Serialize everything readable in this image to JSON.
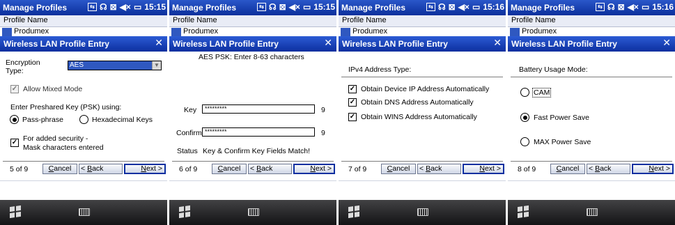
{
  "common": {
    "app_title": "Manage Profiles",
    "list_header": "Profile Name",
    "list_item": "Produmex",
    "dialog_title": "Wireless LAN Profile Entry",
    "close": "✕",
    "cancel": "Cancel",
    "back": "< Back",
    "next": "Next >",
    "icons": [
      "wifi-box-icon",
      "signal-icon",
      "no-connection-icon",
      "speaker-mute-icon",
      "battery-icon"
    ]
  },
  "panels": [
    {
      "time": "15:15",
      "step": "5 of 9",
      "encryption_label": "Encryption Type:",
      "encryption_value": "AES",
      "allow_mixed": "Allow Mixed Mode",
      "psk_label": "Enter Preshared Key (PSK) using:",
      "passphrase": "Pass-phrase",
      "hex": "Hexadecimal Keys",
      "security_line1": "For added security -",
      "security_line2": "Mask characters entered"
    },
    {
      "time": "15:15",
      "step": "6 of 9",
      "heading": "AES PSK: Enter 8-63 characters",
      "key_label": "Key",
      "key_value": "*********",
      "key_count": "9",
      "confirm_label": "Confirm",
      "confirm_value": "*********",
      "confirm_count": "9",
      "status_label": "Status",
      "status_value": "Key & Confirm Key Fields Match!"
    },
    {
      "time": "15:16",
      "step": "7 of 9",
      "heading": "IPv4 Address Type:",
      "options": [
        "Obtain Device IP Address Automatically",
        "Obtain DNS Address Automatically",
        "Obtain WINS Address Automatically"
      ]
    },
    {
      "time": "15:16",
      "step": "8 of 9",
      "heading": "Battery Usage Mode:",
      "modes": [
        "CAM",
        "Fast Power Save",
        "MAX Power Save"
      ],
      "selected": "Fast Power Save"
    }
  ],
  "colors": {
    "titlebar": "#0b2f9c",
    "accent": "#2f58c0",
    "taskbar": "#1a1a1c"
  }
}
